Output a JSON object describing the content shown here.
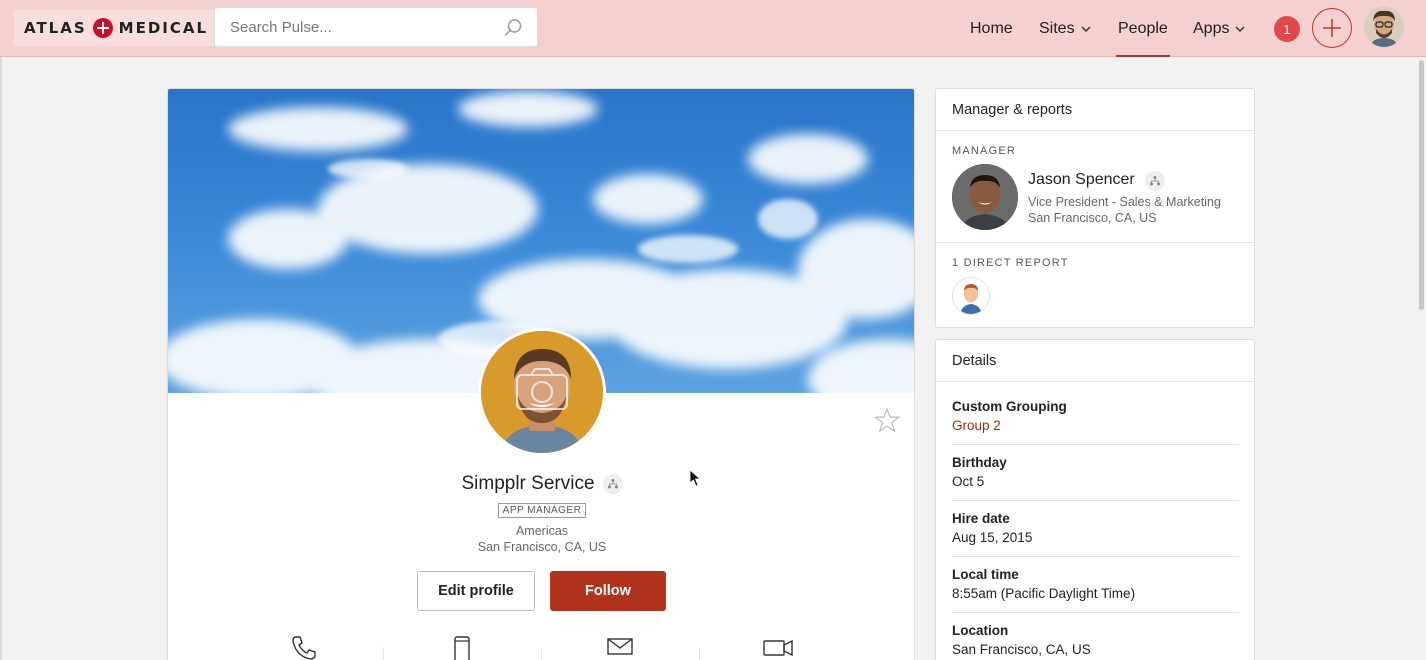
{
  "header": {
    "logo_left": "ATLAS",
    "logo_right": "MEDICAL",
    "search_placeholder": "Search Pulse...",
    "nav": [
      {
        "label": "Home"
      },
      {
        "label": "Sites"
      },
      {
        "label": "People"
      },
      {
        "label": "Apps"
      }
    ],
    "notification_count": "1",
    "accent_color": "#b03a2e"
  },
  "profile": {
    "name": "Simpplr Service",
    "role_badge": "APP MANAGER",
    "region": "Americas",
    "location": "San Francisco, CA, US",
    "edit_label": "Edit profile",
    "follow_label": "Follow"
  },
  "manager_panel": {
    "title": "Manager & reports",
    "manager_caption": "MANAGER",
    "manager_name": "Jason Spencer",
    "manager_title": "Vice President - Sales & Marketing",
    "manager_location": "San Francisco, CA, US",
    "reports_caption": "1 DIRECT REPORT"
  },
  "details_panel": {
    "title": "Details",
    "items": [
      {
        "label": "Custom Grouping",
        "value": "Group 2"
      },
      {
        "label": "Birthday",
        "value": "Oct 5"
      },
      {
        "label": "Hire date",
        "value": "Aug 15, 2015"
      },
      {
        "label": "Local time",
        "value": "8:55am (Pacific Daylight Time)"
      },
      {
        "label": "Location",
        "value": "San Francisco, CA, US"
      }
    ]
  },
  "icons": [
    "search-icon",
    "chevron-down-icon",
    "plus-icon",
    "star-icon",
    "org-chart-icon",
    "phone-icon",
    "mobile-icon",
    "email-icon",
    "video-icon",
    "camera-icon"
  ]
}
